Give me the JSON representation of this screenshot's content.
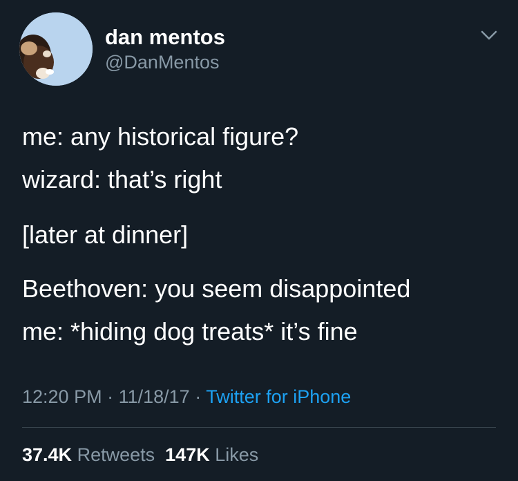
{
  "author": {
    "display_name": "dan mentos",
    "handle": "@DanMentos",
    "avatar_icon": "profile-photo"
  },
  "menu": {
    "icon": "chevron-down-icon"
  },
  "tweet": {
    "lines": [
      "me: any historical figure?",
      "wizard: that’s right",
      "[later at dinner]",
      "Beethoven: you seem disappointed",
      "me: *hiding dog treats* it’s fine"
    ]
  },
  "meta": {
    "time": "12:20 PM",
    "separator": " · ",
    "date": "11/18/17",
    "source": "Twitter for iPhone"
  },
  "stats": {
    "retweets_count": "37.4K",
    "retweets_label": "Retweets",
    "likes_count": "147K",
    "likes_label": "Likes"
  },
  "colors": {
    "background": "#141d26",
    "text_primary": "#ffffff",
    "text_secondary": "#8899a6",
    "link": "#1da1f2",
    "divider": "#38444d"
  }
}
